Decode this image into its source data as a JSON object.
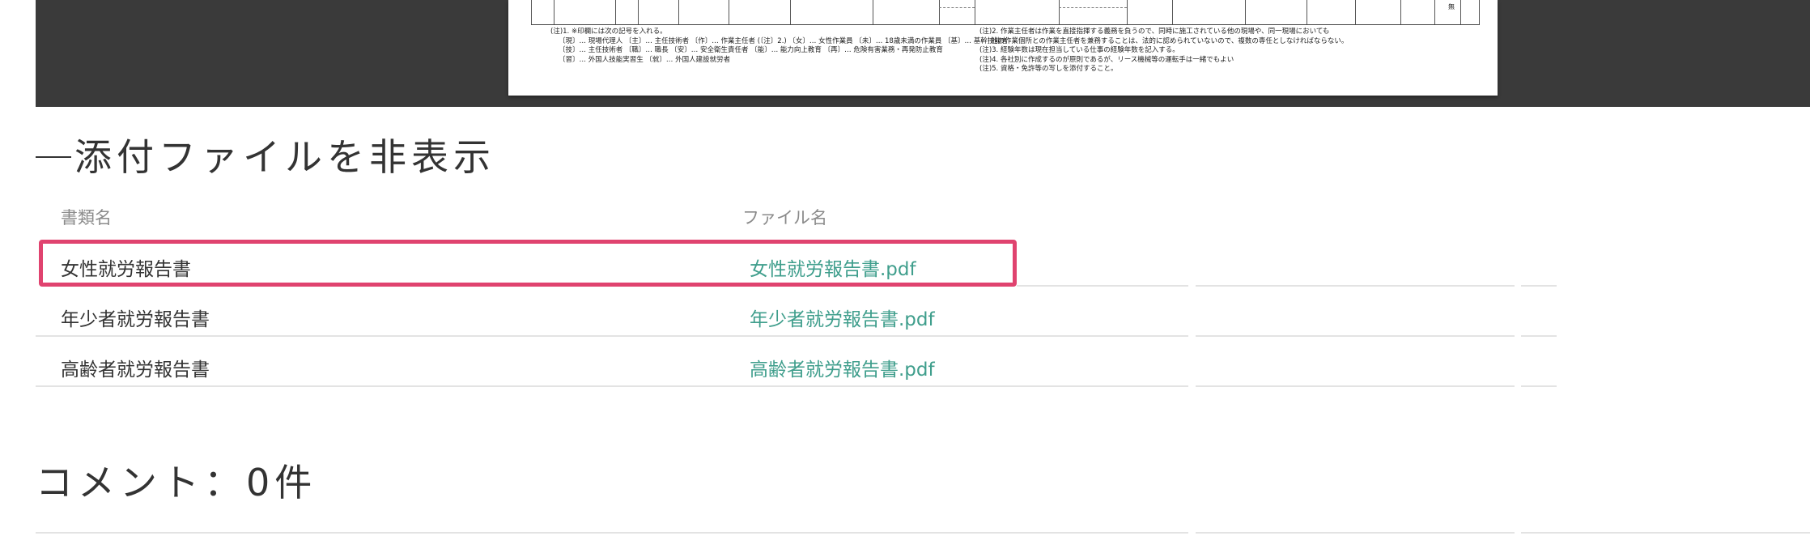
{
  "document_preview": {
    "corner_mark": "無",
    "notes_left": [
      "(注)1. ※印欄には次の記号を入れる。",
      "〔現〕… 現場代理人 〔主〕… 主任技術者 〔作〕… 作業主任者 (〔注〕2.) 〔女〕… 女性作業員 〔未〕… 18歳未満の作業員 〔基〕… 基幹技能者",
      "〔技〕… 主任技術者 〔職〕… 職長 〔安〕… 安全衛生責任者 〔能〕… 能力向上教育 〔再〕… 危険有害業務・再発防止教育",
      "〔習〕… 外国人技能実習生 〔就〕… 外国人建設就労者"
    ],
    "notes_right": [
      "(注)2. 作業主任者は作業を直接指揮する義務を負うので、同時に施工されている他の現場や、同一現場においても",
      "他の作業個所との作業主任者を兼務することは、法的に認められていないので、複数の専任としなければならない。",
      "(注)3. 経験年数は現在担当している仕事の経験年数を記入する。",
      "(注)4. 各社別に作成するのが原則であるが、リース機械等の運転手は一緒でもよい",
      "(注)5. 資格・免許等の写しを添付すること。"
    ]
  },
  "attachments": {
    "title": "添付ファイルを非表示",
    "columns": {
      "document_name": "書類名",
      "file_name": "ファイル名"
    },
    "rows": [
      {
        "document_name": "女性就労報告書",
        "file_name": "女性就労報告書.pdf"
      },
      {
        "document_name": "年少者就労報告書",
        "file_name": "年少者就労報告書.pdf"
      },
      {
        "document_name": "高齢者就労報告書",
        "file_name": "高齢者就労報告書.pdf"
      }
    ]
  },
  "comments": {
    "title": "コメント：0件"
  },
  "colors": {
    "link": "#3f9e8c",
    "highlight": "#e0436f",
    "viewer_bg": "#3a3a3a"
  }
}
